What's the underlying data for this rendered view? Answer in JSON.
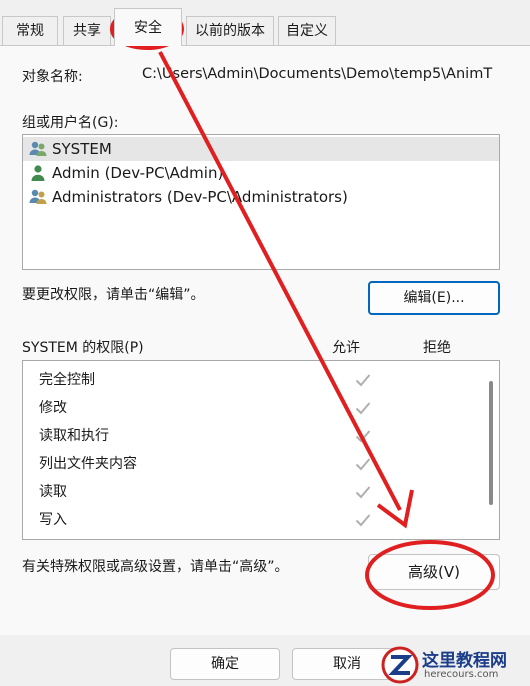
{
  "tabs": [
    {
      "label": "常规",
      "active": false
    },
    {
      "label": "共享",
      "active": false
    },
    {
      "label": "安全",
      "active": true
    },
    {
      "label": "以前的版本",
      "active": false
    },
    {
      "label": "自定义",
      "active": false
    }
  ],
  "object_name": {
    "label": "对象名称:",
    "value": "C:\\Users\\Admin\\Documents\\Demo\\temp5\\AnimT"
  },
  "groups": {
    "label": "组或用户名(G):",
    "items": [
      {
        "name": "SYSTEM",
        "icon": "users-group-icon",
        "selected": true
      },
      {
        "name": "Admin (Dev-PC\\Admin)",
        "icon": "user-icon",
        "selected": false
      },
      {
        "name": "Administrators (Dev-PC\\Administrators)",
        "icon": "users-group-icon",
        "selected": false
      }
    ]
  },
  "edit": {
    "hint": "要更改权限，请单击“编辑”。",
    "button": "编辑(E)..."
  },
  "permissions": {
    "label": "SYSTEM 的权限(P)",
    "allow": "允许",
    "deny": "拒绝",
    "rows": [
      {
        "name": "完全控制",
        "allow": true
      },
      {
        "name": "修改",
        "allow": true
      },
      {
        "name": "读取和执行",
        "allow": true
      },
      {
        "name": "列出文件夹内容",
        "allow": true
      },
      {
        "name": "读取",
        "allow": true
      },
      {
        "name": "写入",
        "allow": true
      }
    ]
  },
  "advanced": {
    "hint": "有关特殊权限或高级设置，请单击“高级”。",
    "button": "高级(V)"
  },
  "footer": {
    "ok": "确定",
    "cancel": "取消"
  },
  "watermark": {
    "site": "这里教程网",
    "url": "herecours.com"
  },
  "colors": {
    "annotation": "#e02020",
    "accent": "#0067c0"
  }
}
